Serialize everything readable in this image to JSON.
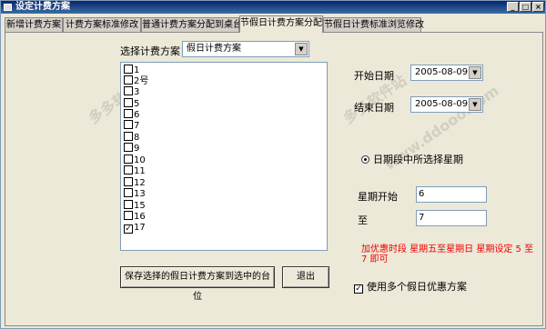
{
  "window": {
    "title": "设定计费方案",
    "controls": [
      "_",
      "□",
      "×"
    ]
  },
  "tabs": [
    {
      "label": "新增计费方案",
      "active": false
    },
    {
      "label": "计费方案标准修改",
      "active": false
    },
    {
      "label": "普通计费方案分配到桌台",
      "active": false
    },
    {
      "label": "节假日计费方案分配",
      "active": true
    },
    {
      "label": "节假日计费标准浏览修改",
      "active": false
    }
  ],
  "scheme": {
    "label": "选择计费方案：",
    "selected": "假日计费方案"
  },
  "list": {
    "items": [
      {
        "label": "1",
        "checked": false
      },
      {
        "label": "2号",
        "checked": false
      },
      {
        "label": "3",
        "checked": false
      },
      {
        "label": "5",
        "checked": false
      },
      {
        "label": "6",
        "checked": false
      },
      {
        "label": "7",
        "checked": false
      },
      {
        "label": "8",
        "checked": false
      },
      {
        "label": "9",
        "checked": false
      },
      {
        "label": "10",
        "checked": false
      },
      {
        "label": "11",
        "checked": false
      },
      {
        "label": "12",
        "checked": false
      },
      {
        "label": "13",
        "checked": false
      },
      {
        "label": "15",
        "checked": false
      },
      {
        "label": "16",
        "checked": false
      },
      {
        "label": "17",
        "checked": true
      }
    ]
  },
  "dates": {
    "start_label": "开始日期",
    "start_value": "2005-08-09",
    "end_label": "结束日期",
    "end_value": "2005-08-09"
  },
  "weekday": {
    "radio_label": "日期段中所选择星期",
    "start_label": "星期开始",
    "start_value": "6",
    "to_label": "至",
    "end_value": "7"
  },
  "hint": "加优惠时段  星期五至星期日   星期设定 5 至 7 即可",
  "buttons": {
    "save": "保存选择的假日计费方案到选中的台位",
    "exit": "退出"
  },
  "multi_scheme": {
    "label": "使用多个假日优惠方案",
    "checked": true
  },
  "watermark": {
    "text": "多多软件站",
    "url": "www.ddooo.com"
  }
}
